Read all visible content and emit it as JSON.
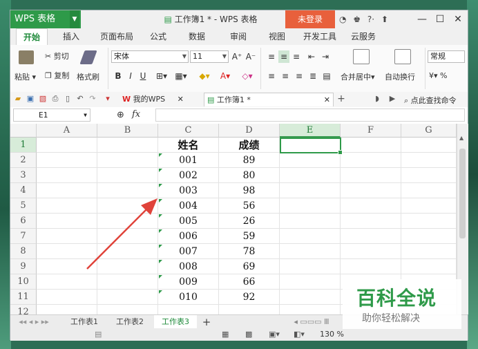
{
  "app": {
    "brand": "WPS 表格",
    "doc_title": "工作簿1 * - WPS 表格",
    "login": "未登录"
  },
  "menu": [
    "开始",
    "插入",
    "页面布局",
    "公式",
    "数据",
    "审阅",
    "视图",
    "开发工具",
    "云服务"
  ],
  "ribbon": {
    "paste": "粘贴",
    "cut": "剪切",
    "copy": "复制",
    "format_painter": "格式刷",
    "font_name": "宋体",
    "font_size": "11",
    "merge_center": "合并居中",
    "wrap_text": "自动换行",
    "number_format": "常规",
    "percent": "%"
  },
  "doc_tabs": [
    "我的WPS",
    "工作簿1 *"
  ],
  "search_hint": "点此查找命令",
  "formula_bar": {
    "cell_ref": "E1",
    "fx": "fx",
    "value": ""
  },
  "columns": [
    "A",
    "B",
    "C",
    "D",
    "E",
    "F",
    "G"
  ],
  "rows": [
    "1",
    "2",
    "3",
    "4",
    "5",
    "6",
    "7",
    "8",
    "9",
    "10",
    "11",
    "12"
  ],
  "table": {
    "headers": [
      "姓名",
      "成绩"
    ],
    "records": [
      [
        "001",
        "89"
      ],
      [
        "002",
        "80"
      ],
      [
        "003",
        "98"
      ],
      [
        "004",
        "56"
      ],
      [
        "005",
        "26"
      ],
      [
        "006",
        "59"
      ],
      [
        "007",
        "78"
      ],
      [
        "008",
        "69"
      ],
      [
        "009",
        "66"
      ],
      [
        "010",
        "92"
      ]
    ]
  },
  "sheets": [
    "工作表1",
    "工作表2",
    "工作表3"
  ],
  "status": {
    "zoom": "130 %"
  },
  "watermark": {
    "title": "百科全说",
    "subtitle": "助你轻松解决"
  },
  "colors": {
    "accent": "#2e9a49",
    "login": "#e8603c",
    "arrow": "#e0433a"
  }
}
